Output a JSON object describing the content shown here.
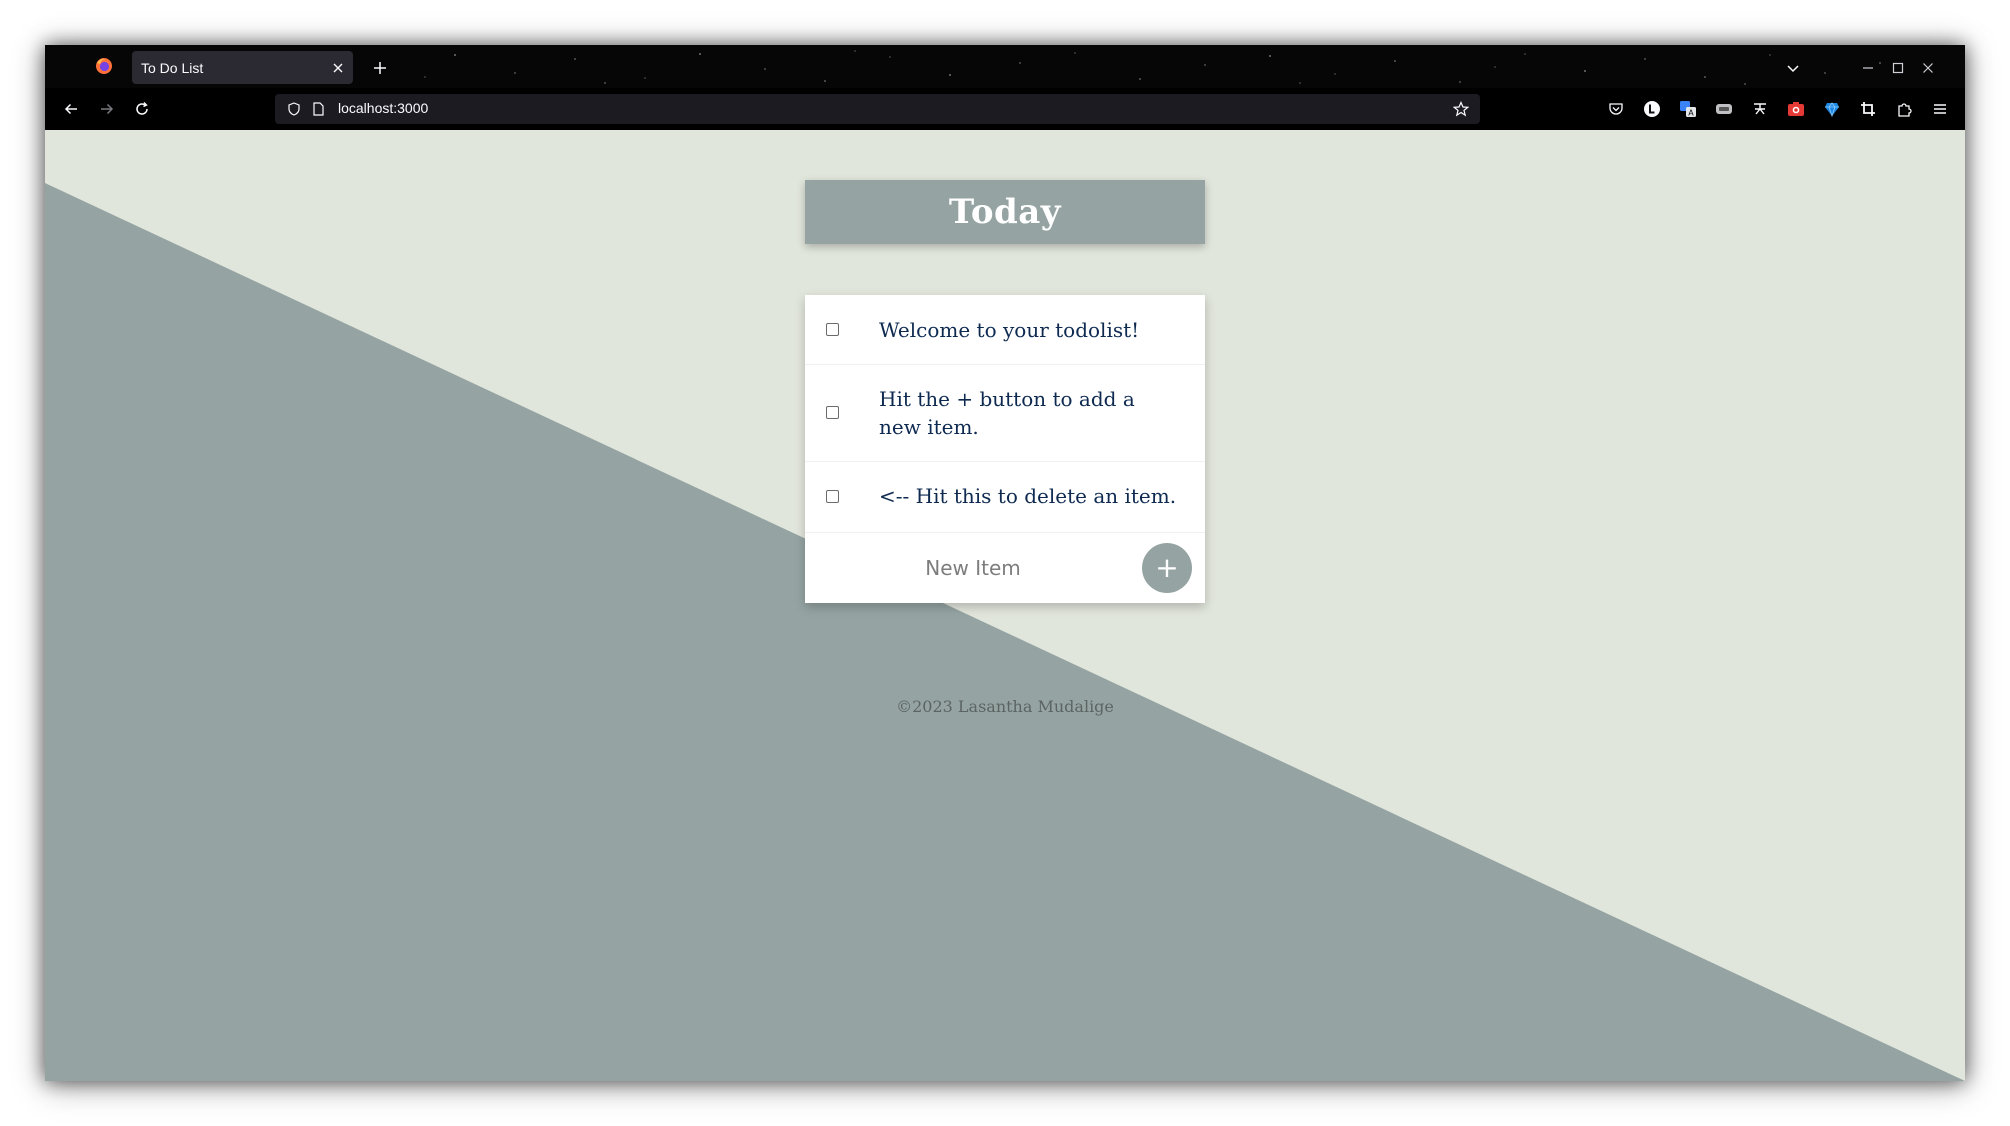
{
  "browser": {
    "tab": {
      "title": "To Do List",
      "close_icon": "close-icon"
    },
    "new_tab_icon": "plus-icon",
    "url": "localhost:3000",
    "window_controls": [
      "chevron-down-icon",
      "minimize-icon",
      "maximize-icon",
      "close-icon"
    ],
    "nav": [
      "back-arrow-icon",
      "forward-arrow-icon",
      "reload-icon"
    ],
    "extensions": [
      "pocket-icon",
      "extension-l-icon",
      "translate-icon",
      "extension-icon",
      "extension-text-icon",
      "screenshot-icon",
      "diamond-icon",
      "crop-icon",
      "extensions-puzzle-icon",
      "menu-icon"
    ]
  },
  "page": {
    "heading": "Today",
    "items": [
      {
        "text": "Welcome to your todolist!",
        "checked": false
      },
      {
        "text": "Hit the + button to add a new item.",
        "checked": false
      },
      {
        "text": "<-- Hit this to delete an item.",
        "checked": false
      }
    ],
    "new_item_placeholder": "New Item",
    "add_button_label": "+",
    "footer": "©2023 Lasantha Mudalige"
  },
  "colors": {
    "accent": "#95a4a3",
    "background_light": "#e1e6dc",
    "item_text": "#0e2a51",
    "browser_chrome": "#000000"
  }
}
